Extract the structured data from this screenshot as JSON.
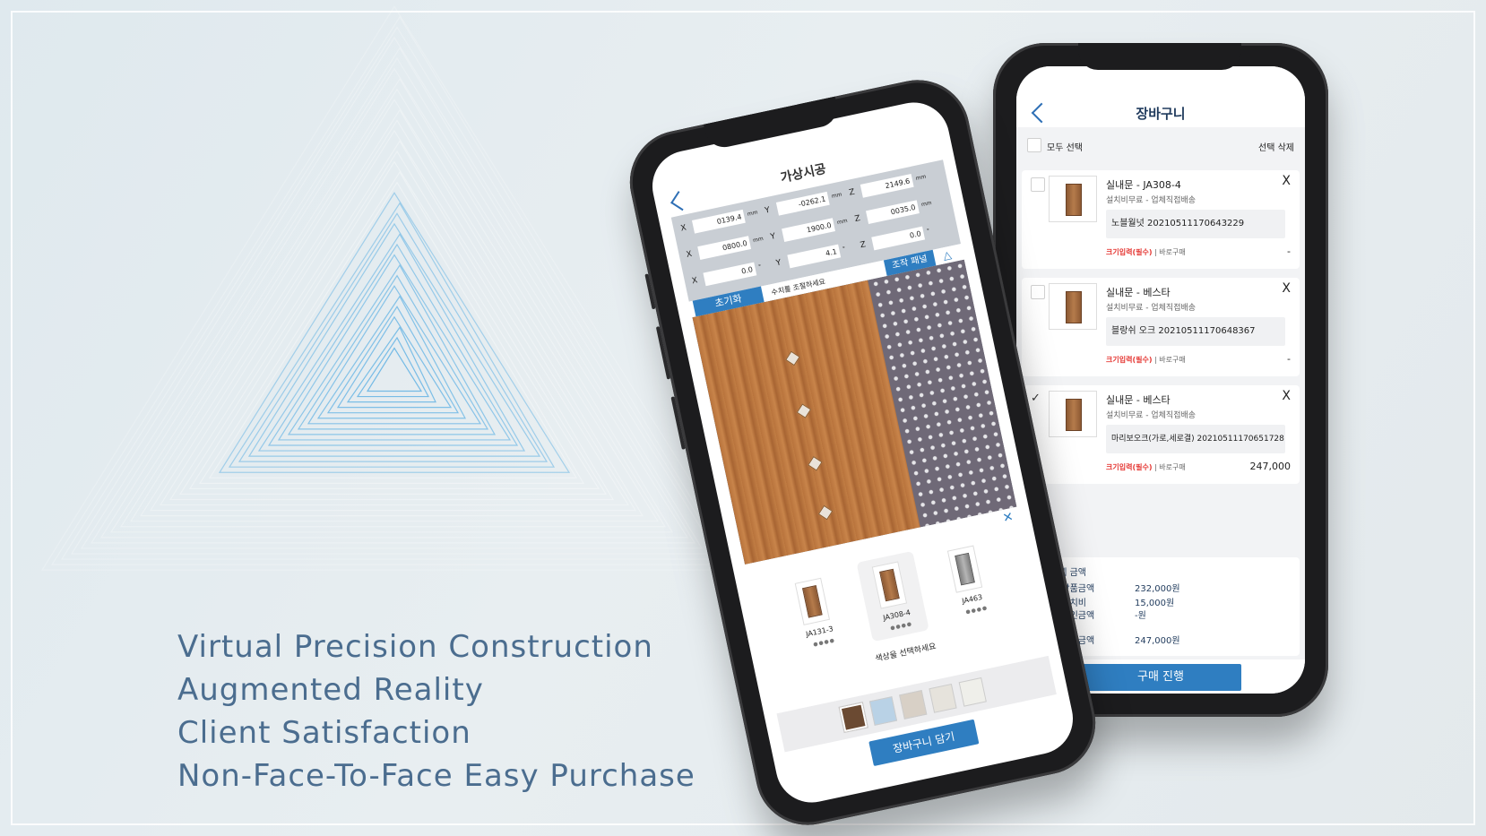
{
  "tagline": [
    "Virtual Precision Construction",
    "Augmented Reality",
    "Client Satisfaction",
    "Non-Face-To-Face Easy Purchase"
  ],
  "colors": {
    "accent": "#2f7ec1",
    "tagline": "#4b6d8f",
    "required": "#e53935"
  },
  "ar_screen": {
    "title": "가상시공",
    "rows": [
      {
        "x": "0139.4",
        "y": "-0262.1",
        "z": "2149.6",
        "unit": "mm"
      },
      {
        "x": "0800.0",
        "y": "1900.0",
        "z": "0035.0",
        "unit": "mm"
      },
      {
        "x": "0.0",
        "y": "4.1",
        "z": "0.0",
        "unit": "°"
      }
    ],
    "labels": {
      "x": "X",
      "y": "Y",
      "z": "Z"
    },
    "reset_label": "초기화",
    "adjust_message": "수치를 조절하세요",
    "panel_label": "조작 패널",
    "color_message": "색상을 선택하세요",
    "add_to_cart_label": "장바구니 담기",
    "doors": [
      {
        "code": "JA131-3"
      },
      {
        "code": "JA308-4"
      },
      {
        "code": "JA463"
      }
    ],
    "swatches": [
      "#6b4a32",
      "#b9d2e6",
      "#d8d0c6",
      "#e6e3dc",
      "#efefea"
    ]
  },
  "cart_screen": {
    "title": "장바구니",
    "select_all_label": "모두 선택",
    "delete_selected_label": "선택 삭제",
    "items": [
      {
        "name": "실내문 - JA308-4",
        "shipping": "설치비무료 - 업체직접배송",
        "option": "노블월넛 20210511170643229",
        "size_label": "크기입력(필수)",
        "buy_now_label": "| 바로구매",
        "price": "-"
      },
      {
        "name": "실내문 - 베스타",
        "shipping": "설치비무료 - 업체직접배송",
        "option": "블랑쉬 오크 20210511170648367",
        "size_label": "크기입력(필수)",
        "buy_now_label": "| 바로구매",
        "price": "-"
      },
      {
        "name": "실내문 - 베스타",
        "shipping": "설치비무료 - 업체직접배송",
        "option": "마리보오크(가로,세로결) 20210511170651728",
        "size_label": "크기입력(필수)",
        "buy_now_label": "| 바로구매",
        "price": "247,000"
      }
    ],
    "payment": {
      "heading": "결제 금액",
      "rows": [
        {
          "label": "총 상품금액",
          "value": "232,000원"
        },
        {
          "label": "총 설치비",
          "value": "15,000원"
        },
        {
          "label": "총 할인금액",
          "value": "-원"
        },
        {
          "label": "총 예상금액",
          "value": "247,000원"
        }
      ]
    },
    "purchase_label": "구매 진행"
  }
}
